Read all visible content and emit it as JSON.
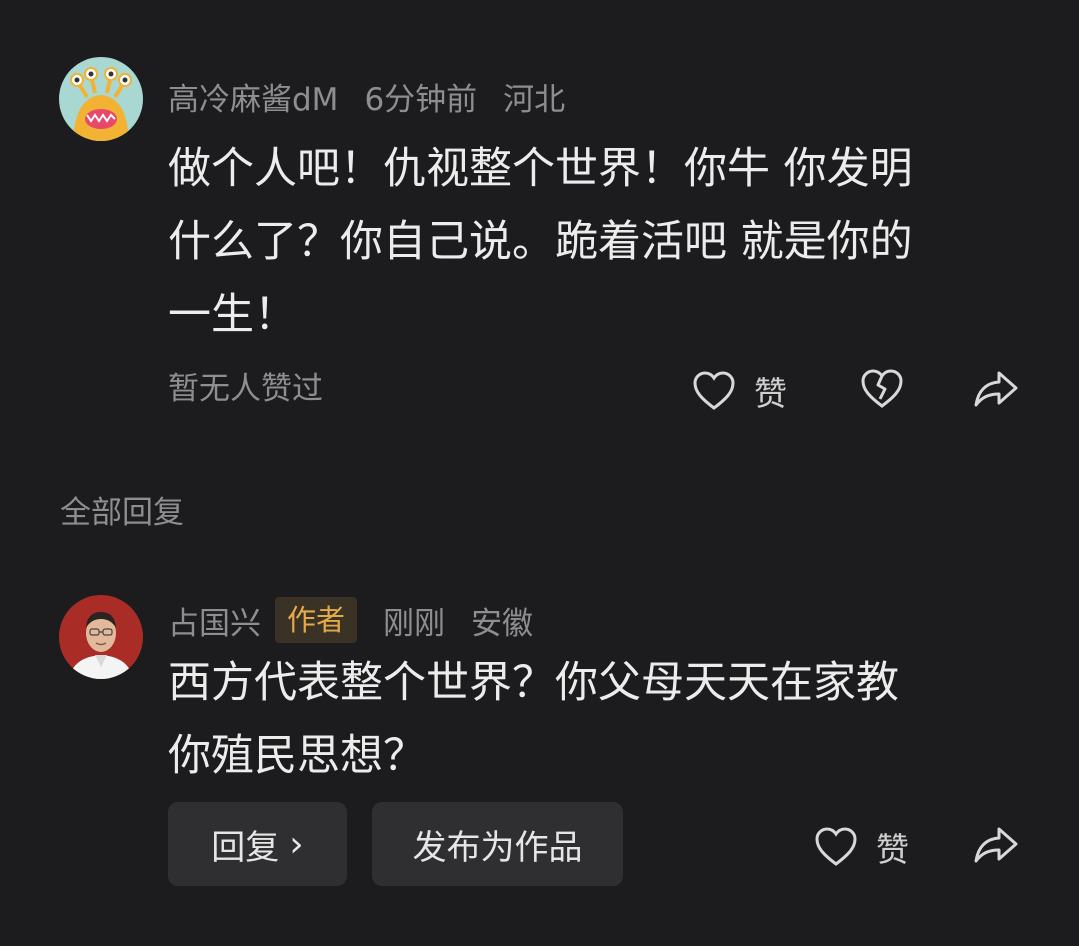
{
  "main_comment": {
    "avatar_icon": "cartoon-monster-avatar",
    "username": "高冷麻酱dM",
    "time": "6分钟前",
    "location": "河北",
    "text_lines": [
      "做个人吧！仇视整个世界！你牛 你发明",
      "什么了？你自己说。跪着活吧 就是你的",
      "一生！"
    ],
    "likes_status": "暂无人赞过",
    "like_label": "赞",
    "icons": {
      "like": "heart-outline-icon",
      "dislike": "broken-heart-icon",
      "share": "share-arrow-icon"
    }
  },
  "replies_header": "全部回复",
  "reply": {
    "avatar_icon": "man-portrait-avatar",
    "username": "占国兴",
    "author_badge": "作者",
    "time": "刚刚",
    "location": "安徽",
    "text_lines": [
      "西方代表整个世界？你父母天天在家教",
      "你殖民思想？"
    ],
    "reply_button_label": "回复",
    "reply_chevron": "›",
    "publish_button_label": "发布为作品",
    "like_label": "赞",
    "icons": {
      "like": "heart-outline-icon",
      "share": "share-arrow-icon"
    }
  },
  "colors": {
    "background": "#1c1c1e",
    "text_primary": "#ececec",
    "text_secondary": "#8e8e92",
    "author_badge_text": "#e5a94a",
    "author_badge_bg": "#3a3225",
    "button_bg": "#2f2f31"
  }
}
